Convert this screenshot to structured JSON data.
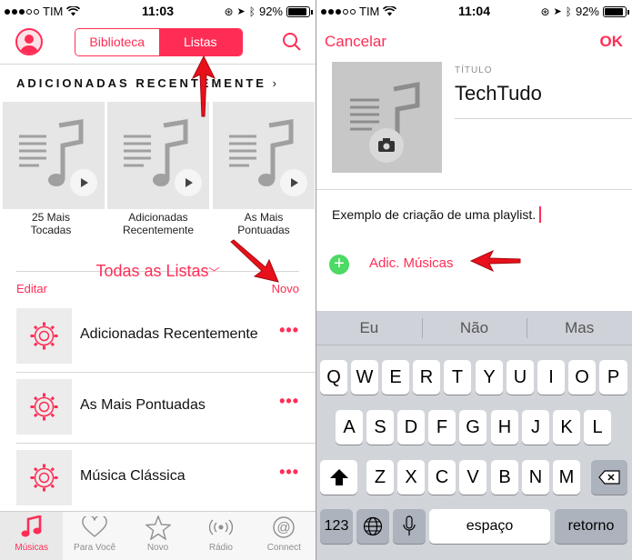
{
  "left": {
    "status": {
      "carrier": "TIM",
      "time": "11:03",
      "battery": "92%"
    },
    "segments": [
      "Biblioteca",
      "Listas"
    ],
    "active_segment": "Listas",
    "recent_title": "ADICIONADAS RECENTEMENTE",
    "recent_chevron": "›",
    "tiles": [
      {
        "caption1": "25 Mais",
        "caption2": "Tocadas"
      },
      {
        "caption1": "Adicionadas",
        "caption2": "Recentemente"
      },
      {
        "caption1": "As Mais",
        "caption2": "Pontuadas"
      }
    ],
    "all_lists": "Todas as Listas",
    "all_lists_chevron": "﹀",
    "edit_label": "Editar",
    "new_label": "Novo",
    "playlists": [
      {
        "label": "Adicionadas Recentemente"
      },
      {
        "label": "As Mais Pontuadas"
      },
      {
        "label": "Música Clássica"
      }
    ],
    "more_glyph": "•••",
    "tabs": [
      {
        "label": "Músicas",
        "icon": "music-note-icon"
      },
      {
        "label": "Para Você",
        "icon": "heart-icon"
      },
      {
        "label": "Novo",
        "icon": "star-icon"
      },
      {
        "label": "Rádio",
        "icon": "radio-icon"
      },
      {
        "label": "Connect",
        "icon": "at-sign-icon"
      }
    ],
    "active_tab": "Músicas"
  },
  "right": {
    "status": {
      "carrier": "TIM",
      "time": "11:04",
      "battery": "92%"
    },
    "cancel_label": "Cancelar",
    "ok_label": "OK",
    "title_caption": "TÍTULO",
    "title_value": "TechTudo",
    "description": "Exemplo de criação de uma playlist.",
    "add_label": "Adic. Músicas",
    "suggestions": [
      "Eu",
      "Não",
      "Mas"
    ],
    "keyboard": {
      "row1": [
        "Q",
        "W",
        "E",
        "R",
        "T",
        "Y",
        "U",
        "I",
        "O",
        "P"
      ],
      "row2": [
        "A",
        "S",
        "D",
        "F",
        "G",
        "H",
        "J",
        "K",
        "L"
      ],
      "row3": [
        "Z",
        "X",
        "C",
        "V",
        "B",
        "N",
        "M"
      ],
      "numbers_key": "123",
      "space_key": "espaço",
      "return_key": "retorno"
    }
  },
  "colors": {
    "accent": "#ff2d55",
    "add_green": "#4cd964",
    "arrow_red": "#e8101b"
  }
}
